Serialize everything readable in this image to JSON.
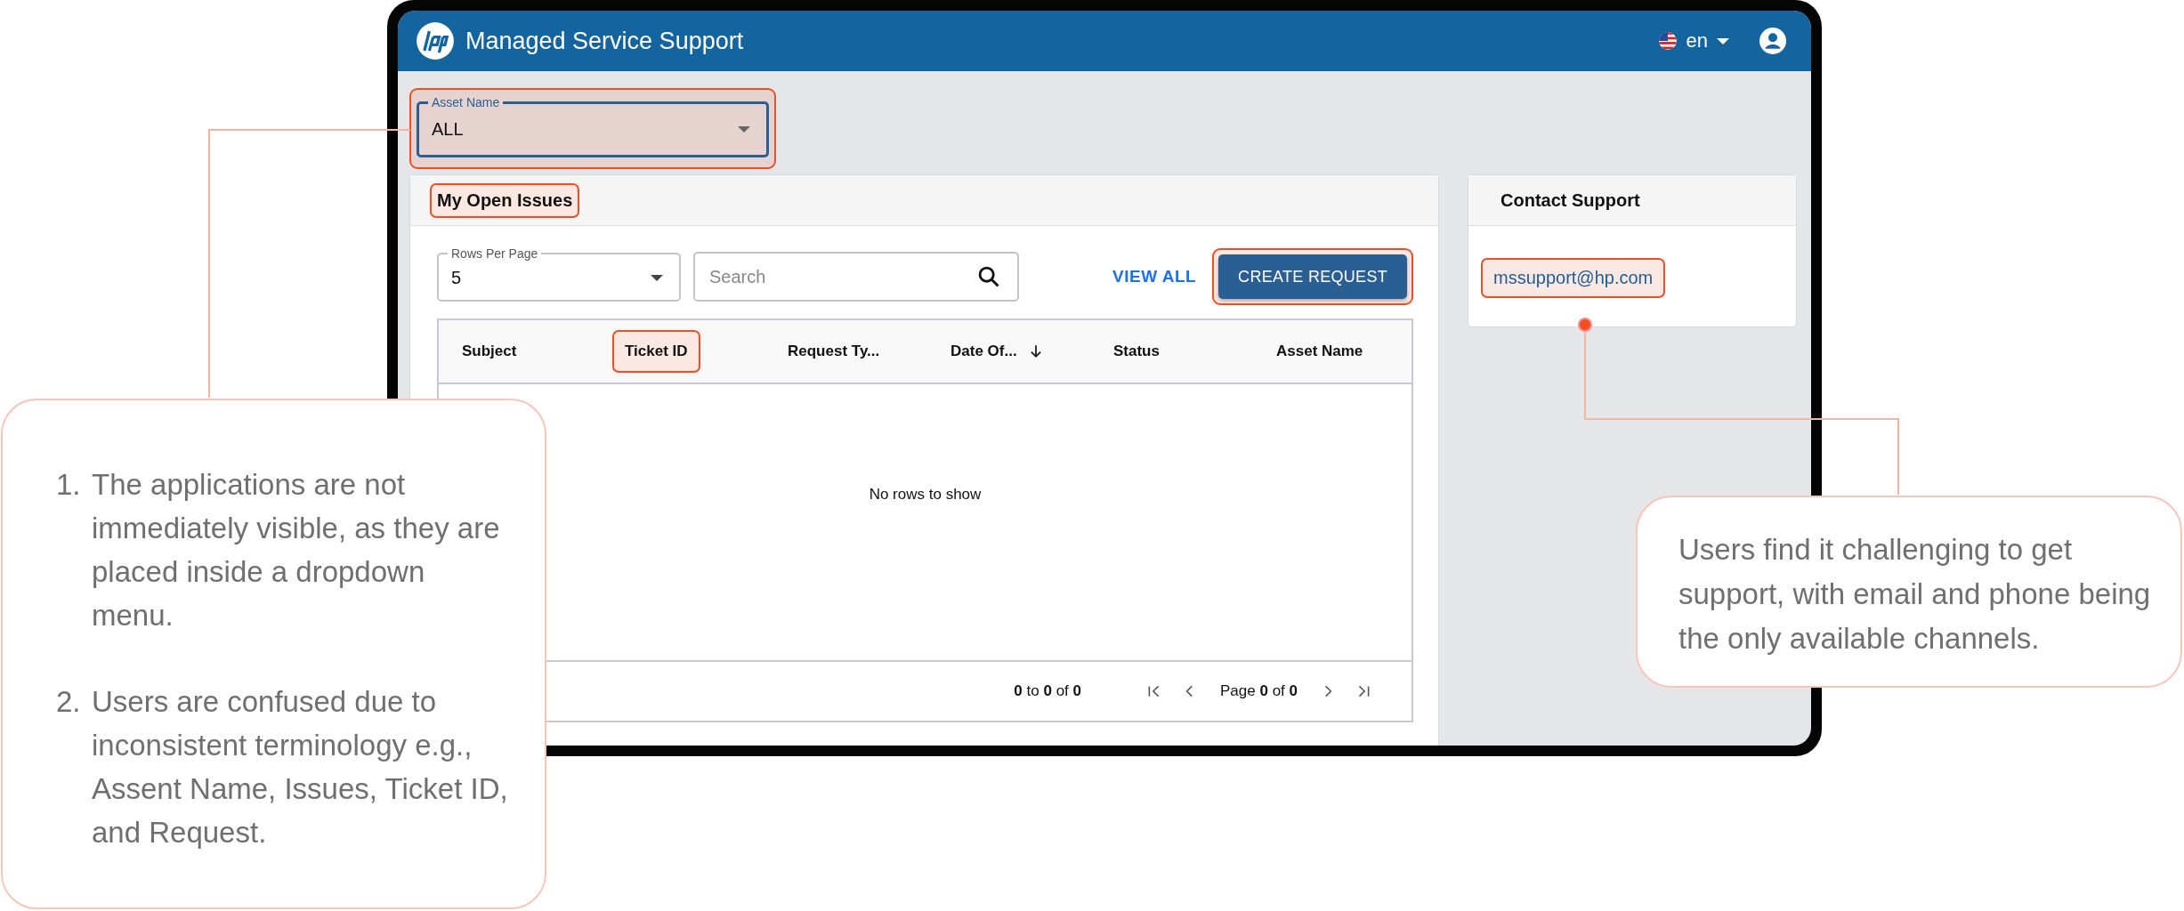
{
  "app": {
    "title": "Managed Service Support",
    "language": "en"
  },
  "asset_filter": {
    "label": "Asset Name",
    "value": "ALL",
    "highlighted": true
  },
  "open_issues": {
    "title": "My Open Issues",
    "title_highlighted": true,
    "rows_per_page": {
      "label": "Rows Per Page",
      "value": "5"
    },
    "search": {
      "placeholder": "Search"
    },
    "view_all": "VIEW ALL",
    "create_button": {
      "label": "CREATE REQUEST",
      "highlighted": true
    },
    "columns": [
      {
        "label": "Subject",
        "highlighted": false,
        "sorted_descending": false
      },
      {
        "label": "Ticket ID",
        "highlighted": true,
        "sorted_descending": false
      },
      {
        "label": "Request Ty...",
        "highlighted": false,
        "sorted_descending": false
      },
      {
        "label": "Date Of...",
        "highlighted": false,
        "sorted_descending": true
      },
      {
        "label": "Status",
        "highlighted": false,
        "sorted_descending": false
      },
      {
        "label": "Asset Name",
        "highlighted": false,
        "sorted_descending": false
      }
    ],
    "empty_message": "No rows to show",
    "pagination": {
      "summary": "**0** to **0** of **0**",
      "page": "Page **0** of **0**"
    }
  },
  "contact": {
    "title": "Contact Support",
    "email": "mssupport@hp.com",
    "email_highlighted": true
  },
  "annotations": [
    {
      "kind": "list",
      "items": [
        {
          "number": "1.",
          "text": "The applications are not immediately visible, as they are placed inside a dropdown menu."
        },
        {
          "number": "2.",
          "text": "Users are confused due to inconsistent terminology e.g., Assent Name, Issues, Ticket ID, and Request."
        }
      ]
    },
    {
      "kind": "text",
      "text": "Users find it challenging to get support, with email and phone being the only available channels."
    }
  ]
}
